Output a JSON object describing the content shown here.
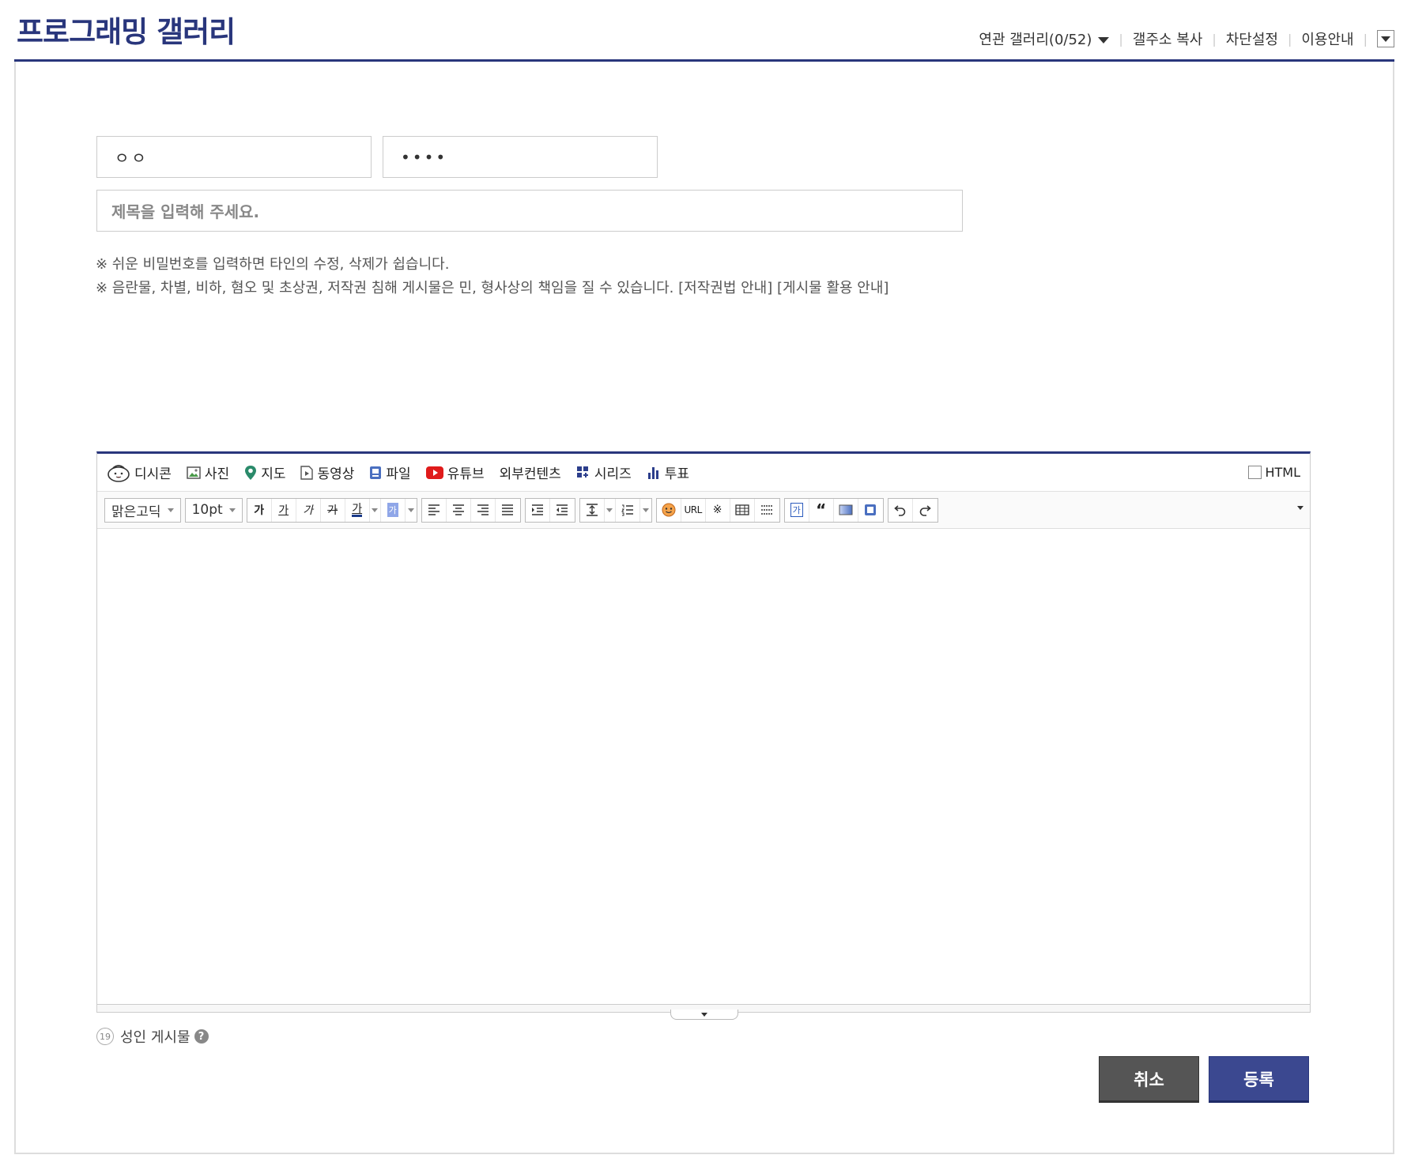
{
  "header": {
    "title": "프로그래밍 갤러리",
    "links": {
      "related": "연관 갤러리(0/52)",
      "copy_address": "갤주소 복사",
      "block_settings": "차단설정",
      "guide": "이용안내"
    }
  },
  "form": {
    "nickname_value": "ㅇㅇ",
    "password_value": "••••",
    "subject_placeholder": "제목을 입력해 주세요.",
    "notice1": "※ 쉬운 비밀번호를 입력하면 타인의 수정, 삭제가 쉽습니다.",
    "notice2": "※ 음란물, 차별, 비하, 혐오 및 초상권, 저작권 침해 게시물은 민, 형사상의 책임을 질 수 있습니다.",
    "copyright_link": "[저작권법 안내]",
    "usage_link": "[게시물 활용 안내]"
  },
  "editor": {
    "toolbar1": {
      "dccon": "디시콘",
      "photo": "사진",
      "map": "지도",
      "video": "동영상",
      "file": "파일",
      "youtube": "유튜브",
      "external": "외부컨텐츠",
      "series": "시리즈",
      "poll": "투표",
      "html": "HTML"
    },
    "toolbar2": {
      "font": "맑은고딕",
      "size": "10pt",
      "bold": "가",
      "underline": "가",
      "italic": "가",
      "strike": "가",
      "fontcolor": "가",
      "bgcolor": "가",
      "url": "URL",
      "special": "※",
      "box": "가"
    }
  },
  "adult": {
    "badge": "19",
    "label": "성인 게시물",
    "help": "?"
  },
  "buttons": {
    "cancel": "취소",
    "submit": "등록"
  },
  "colors": {
    "accent": "#29367c",
    "submit": "#3b4890",
    "cancel": "#555555"
  }
}
